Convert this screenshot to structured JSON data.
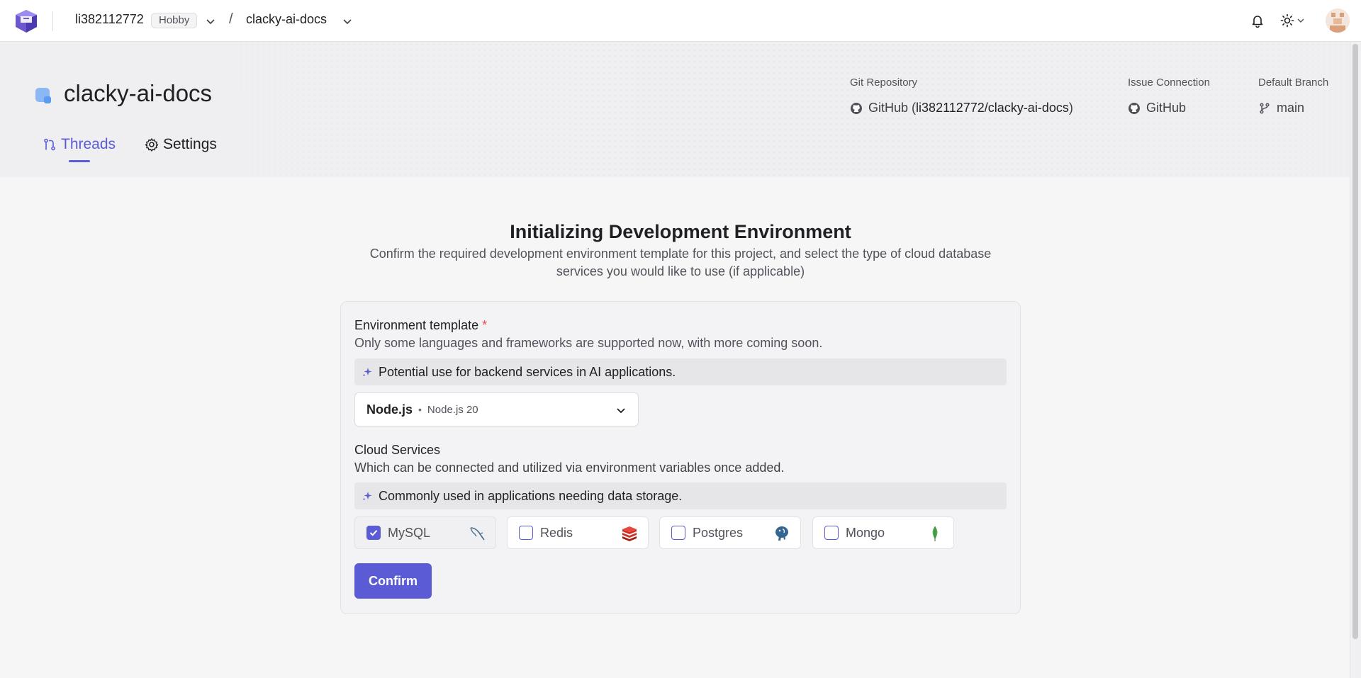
{
  "nav": {
    "org_name": "li382112772",
    "plan_badge": "Hobby",
    "separator": "/",
    "project_name": "clacky-ai-docs"
  },
  "header": {
    "project_title": "clacky-ai-docs",
    "tabs": [
      {
        "label": "Threads",
        "active": true
      },
      {
        "label": "Settings",
        "active": false
      }
    ],
    "git_repository": {
      "label": "Git Repository",
      "provider": "GitHub",
      "open_paren": "(",
      "repo": "li382112772/clacky-ai-docs",
      "close_paren": ")"
    },
    "issue_connection": {
      "label": "Issue Connection",
      "value": "GitHub"
    },
    "default_branch": {
      "label": "Default Branch",
      "value": "main"
    }
  },
  "main": {
    "title": "Initializing Development Environment",
    "subtitle": "Confirm the required development environment template for this project, and select the type of cloud database services you would like to use (if applicable)"
  },
  "env_template": {
    "label": "Environment template",
    "required_mark": "*",
    "description": "Only some languages and frameworks are supported now, with more coming soon.",
    "hint": "Potential use for backend services in AI applications.",
    "selected": "Node.js",
    "separator": "•",
    "version": "Node.js 20"
  },
  "cloud_services": {
    "label": "Cloud Services",
    "description": "Which can be connected and utilized via environment variables once added.",
    "hint": "Commonly used in applications needing data storage.",
    "services": [
      {
        "label": "MySQL",
        "checked": true
      },
      {
        "label": "Redis",
        "checked": false
      },
      {
        "label": "Postgres",
        "checked": false
      },
      {
        "label": "Mongo",
        "checked": false
      }
    ]
  },
  "confirm_label": "Confirm",
  "colors": {
    "accent": "#5b5bd6",
    "required": "#e5484d",
    "page_bg": "#f6f6f7"
  }
}
